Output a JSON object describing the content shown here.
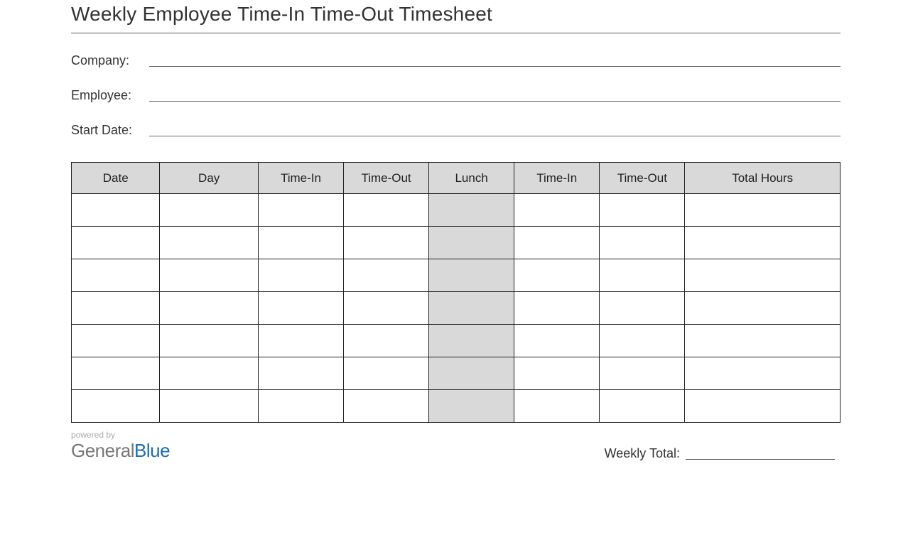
{
  "title": "Weekly Employee Time-In Time-Out Timesheet",
  "meta": {
    "company_label": "Company:",
    "employee_label": "Employee:",
    "startdate_label": "Start Date:"
  },
  "table": {
    "headers": [
      "Date",
      "Day",
      "Time-In",
      "Time-Out",
      "Lunch",
      "Time-In",
      "Time-Out",
      "Total Hours"
    ],
    "rows": [
      [
        "",
        "",
        "",
        "",
        "",
        "",
        "",
        ""
      ],
      [
        "",
        "",
        "",
        "",
        "",
        "",
        "",
        ""
      ],
      [
        "",
        "",
        "",
        "",
        "",
        "",
        "",
        ""
      ],
      [
        "",
        "",
        "",
        "",
        "",
        "",
        "",
        ""
      ],
      [
        "",
        "",
        "",
        "",
        "",
        "",
        "",
        ""
      ],
      [
        "",
        "",
        "",
        "",
        "",
        "",
        "",
        ""
      ],
      [
        "",
        "",
        "",
        "",
        "",
        "",
        "",
        ""
      ]
    ]
  },
  "footer": {
    "powered_by": "powered by",
    "brand_general": "General",
    "brand_blue": "Blue",
    "weekly_total_label": "Weekly Total:"
  }
}
